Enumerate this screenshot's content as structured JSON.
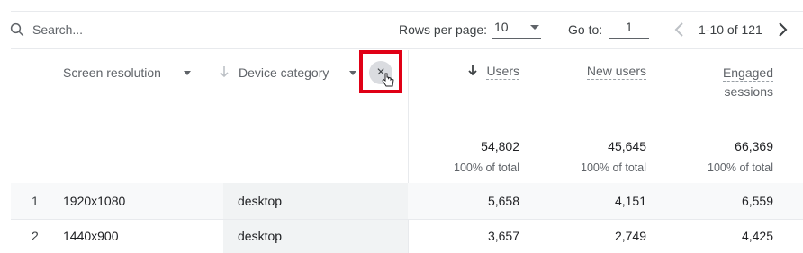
{
  "search": {
    "placeholder": "Search..."
  },
  "pagination": {
    "rows_per_page_label": "Rows per page:",
    "rows_per_page_value": "10",
    "goto_label": "Go to:",
    "goto_value": "1",
    "range_text": "1-10 of 121"
  },
  "dimensions": {
    "primary": "Screen resolution",
    "secondary": "Device category",
    "remove_glyph": "×"
  },
  "metrics": [
    {
      "label": "Users",
      "label_line2": "",
      "total": "54,802",
      "pct": "100% of total"
    },
    {
      "label": "New users",
      "label_line2": "",
      "total": "45,645",
      "pct": "100% of total"
    },
    {
      "label": "Engaged",
      "label_line2": "sessions",
      "total": "66,369",
      "pct": "100% of total"
    }
  ],
  "rows": [
    {
      "index": "1",
      "resolution": "1920x1080",
      "device": "desktop",
      "users": "5,658",
      "new_users": "4,151",
      "engaged": "6,559"
    },
    {
      "index": "2",
      "resolution": "1440x900",
      "device": "desktop",
      "users": "3,657",
      "new_users": "2,749",
      "engaged": "4,425"
    }
  ],
  "colors": {
    "highlight": "#e00016",
    "accent_text": "#3c4043"
  }
}
